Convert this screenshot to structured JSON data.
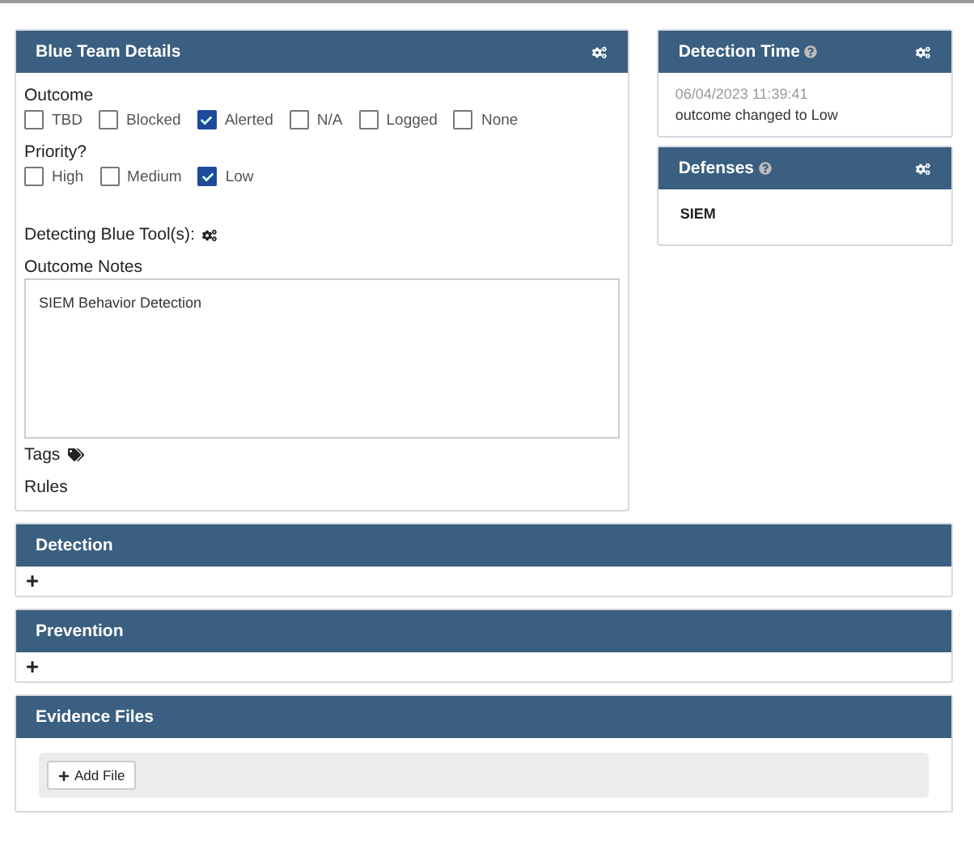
{
  "blue_team": {
    "title": "Blue Team Details",
    "outcome": {
      "label": "Outcome",
      "options": [
        {
          "label": "TBD",
          "checked": false
        },
        {
          "label": "Blocked",
          "checked": false
        },
        {
          "label": "Alerted",
          "checked": true
        },
        {
          "label": "N/A",
          "checked": false
        },
        {
          "label": "Logged",
          "checked": false
        },
        {
          "label": "None",
          "checked": false
        }
      ]
    },
    "priority": {
      "label": "Priority?",
      "options": [
        {
          "label": "High",
          "checked": false
        },
        {
          "label": "Medium",
          "checked": false
        },
        {
          "label": "Low",
          "checked": true
        }
      ]
    },
    "detecting_tools": {
      "label": "Detecting Blue Tool(s):"
    },
    "outcome_notes": {
      "label": "Outcome Notes",
      "value": "SIEM Behavior Detection"
    },
    "tags": {
      "label": "Tags"
    },
    "rules": {
      "label": "Rules"
    }
  },
  "detection_time": {
    "title": "Detection Time",
    "timestamp": "06/04/2023 11:39:41",
    "note": "outcome changed to Low"
  },
  "defenses": {
    "title": "Defenses",
    "items": [
      "SIEM"
    ]
  },
  "detection": {
    "title": "Detection"
  },
  "prevention": {
    "title": "Prevention"
  },
  "evidence_files": {
    "title": "Evidence Files",
    "button": "Add File"
  }
}
